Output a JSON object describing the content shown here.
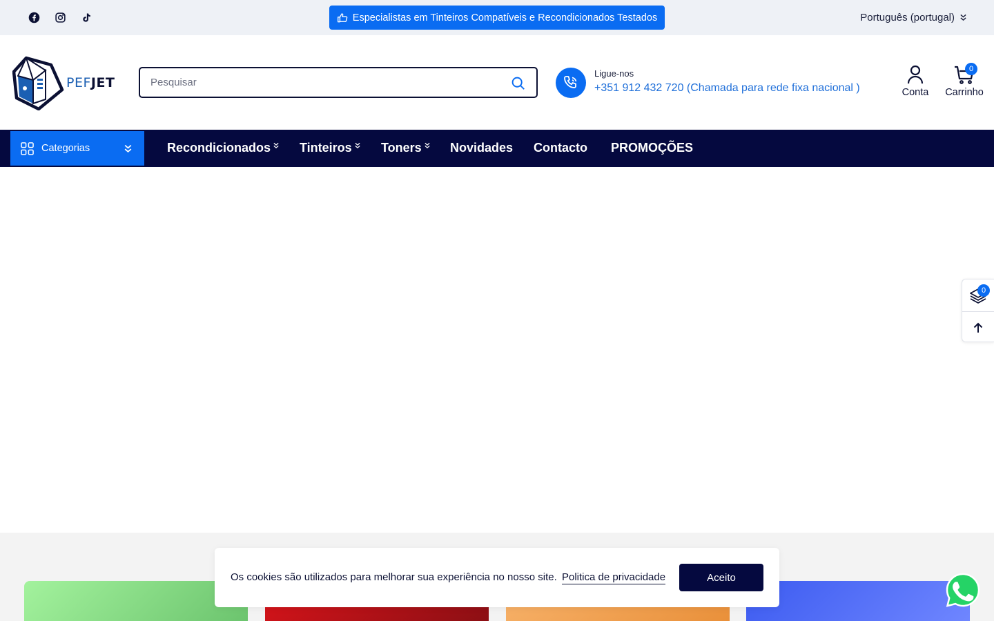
{
  "topbar": {
    "social": [
      "facebook-icon",
      "instagram-icon",
      "tiktok-icon"
    ],
    "promo_text": "Especialistas em Tinteiros Compatíveis e Recondicionados Testados",
    "language": "Português (portugal)"
  },
  "header": {
    "logo_part1": "PEF",
    "logo_part2": "JET",
    "search_placeholder": "Pesquisar",
    "call_label": "Ligue-nos",
    "call_number": "+351 912 432 720 (Chamada para rede fixa nacional )",
    "account_label": "Conta",
    "cart_label": "Carrinho",
    "cart_count": "0"
  },
  "nav": {
    "categories_label": "Categorias",
    "items": [
      {
        "label": "Recondicionados",
        "dropdown": true
      },
      {
        "label": "Tinteiros",
        "dropdown": true
      },
      {
        "label": "Toners",
        "dropdown": true
      },
      {
        "label": "Novidades",
        "dropdown": false
      },
      {
        "label": "Contacto",
        "dropdown": false
      },
      {
        "label": "PROMOÇÕES",
        "dropdown": false
      }
    ]
  },
  "sidetools": {
    "compare_count": "0"
  },
  "cookie": {
    "text": "Os cookies são utilizados para melhorar sua experiência no nosso site.",
    "policy_link": "Politica de privacidade",
    "accept_label": "Aceito"
  },
  "colors": {
    "accent": "#0a6cf2",
    "navy": "#05093f",
    "topbar_bg": "#eef1f6",
    "whatsapp": "#25d366"
  }
}
